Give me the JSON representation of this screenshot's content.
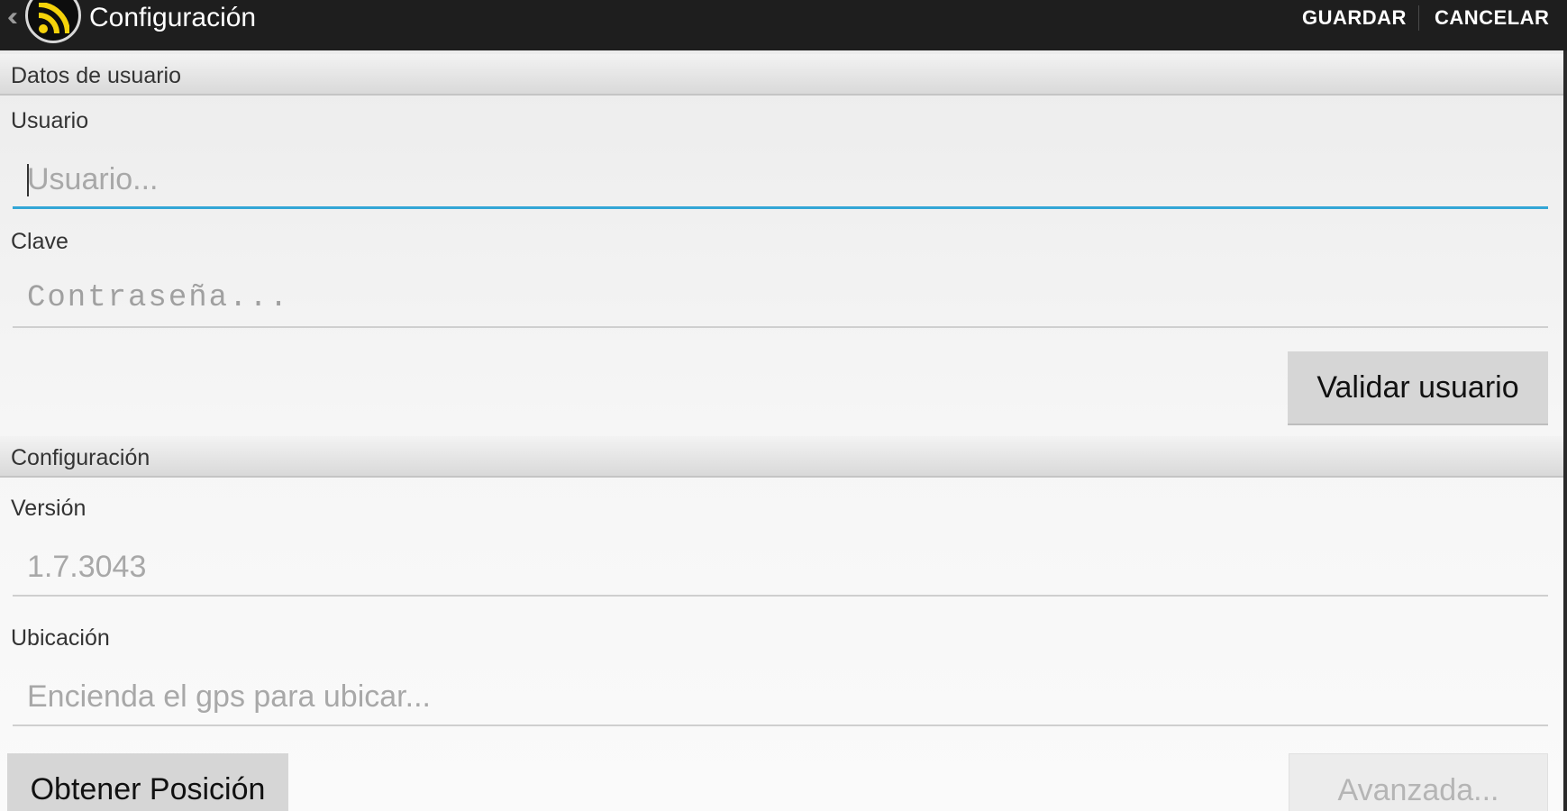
{
  "action_bar": {
    "title": "Configuración",
    "save_label": "GUARDAR",
    "cancel_label": "CANCELAR",
    "logo_icon": "rss-feed-icon",
    "accent_color": "#f5d20a"
  },
  "user_section": {
    "header": "Datos de usuario",
    "username_label": "Usuario",
    "username_placeholder": "Usuario...",
    "password_label": "Clave",
    "password_placeholder": "Contraseña...",
    "validate_button": "Validar usuario"
  },
  "config_section": {
    "header": "Configuración",
    "version_label": "Versión",
    "version_value": "1.7.3043",
    "location_label": "Ubicación",
    "location_placeholder": "Encienda el gps para ubicar...",
    "get_position_button": "Obtener Posición",
    "advanced_button": "Avanzada..."
  },
  "colors": {
    "focus_underline": "#33a6d6",
    "action_bar_bg": "#1e1e1e"
  }
}
